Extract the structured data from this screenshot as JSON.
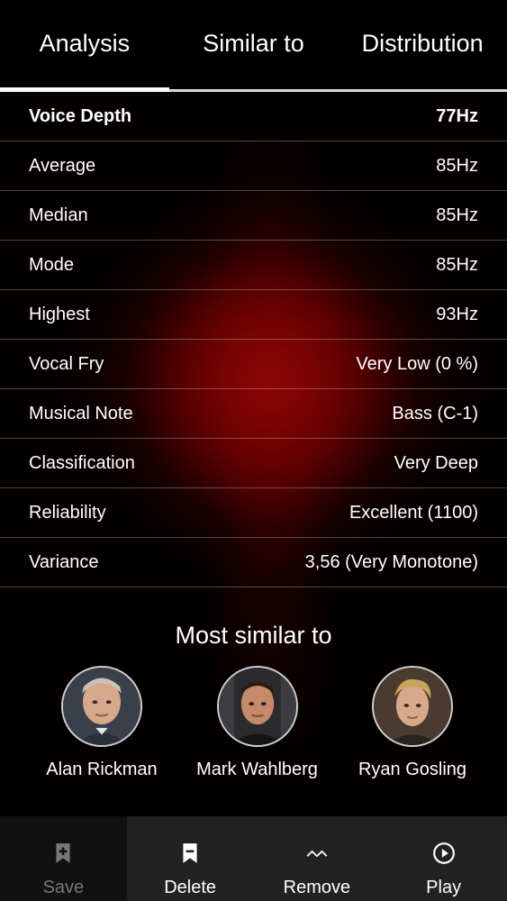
{
  "tabs": [
    {
      "label": "Analysis",
      "active": true
    },
    {
      "label": "Similar to",
      "active": false
    },
    {
      "label": "Distribution",
      "active": false
    }
  ],
  "stats": {
    "header": {
      "label": "Voice Depth",
      "value": "77Hz"
    },
    "rows": [
      {
        "label": "Average",
        "value": "85Hz"
      },
      {
        "label": "Median",
        "value": "85Hz"
      },
      {
        "label": "Mode",
        "value": "85Hz"
      },
      {
        "label": "Highest",
        "value": "93Hz"
      },
      {
        "label": "Vocal Fry",
        "value": "Very Low (0 %)"
      },
      {
        "label": "Musical Note",
        "value": "Bass (C-1)"
      },
      {
        "label": "Classification",
        "value": "Very Deep"
      },
      {
        "label": "Reliability",
        "value": "Excellent (1100)"
      },
      {
        "label": "Variance",
        "value": "3,56 (Very Monotone)"
      }
    ]
  },
  "similar": {
    "title": "Most similar to",
    "people": [
      {
        "name": "Alan Rickman",
        "icon": "avatar-photo"
      },
      {
        "name": "Mark Wahlberg",
        "icon": "avatar-photo"
      },
      {
        "name": "Ryan Gosling",
        "icon": "avatar-photo"
      }
    ]
  },
  "bottom_nav": {
    "save": {
      "label": "Save",
      "icon": "bookmark-add-icon"
    },
    "delete": {
      "label": "Delete",
      "icon": "bookmark-remove-icon"
    },
    "remove": {
      "label": "Remove",
      "icon": "chevron-wave-icon"
    },
    "play": {
      "label": "Play",
      "icon": "play-circle-icon"
    }
  },
  "colors": {
    "background": "#000000",
    "glow": "#8c0000",
    "nav_background": "#222222",
    "disabled_text": "#777777"
  }
}
